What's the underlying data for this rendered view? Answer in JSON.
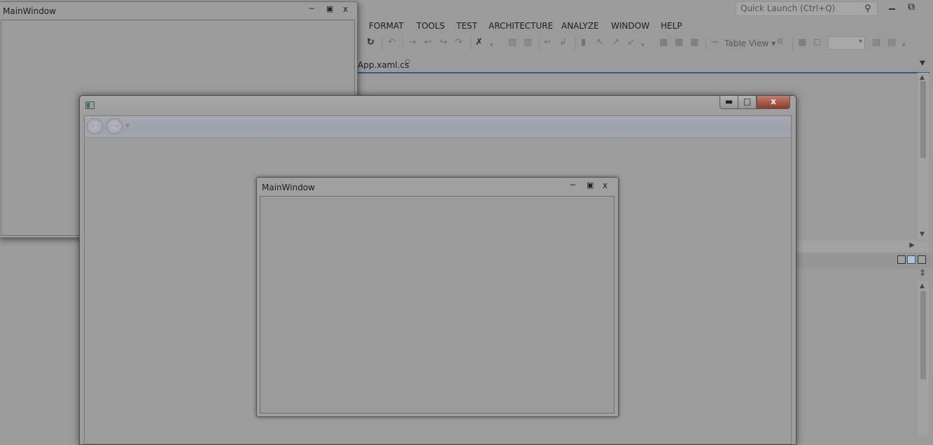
{
  "vs": {
    "quick_launch_placeholder": "Quick Launch (Ctrl+Q)",
    "menu": [
      "FORMAT",
      "TOOLS",
      "TEST",
      "ARCHITECTURE",
      "ANALYZE",
      "WINDOW",
      "HELP"
    ],
    "toolbar": {
      "table_view_label": "Table View"
    },
    "doc_tab": "App.xaml.cs"
  },
  "small_window": {
    "title": "MainWindow"
  },
  "inner_window": {
    "title": "MainWindow"
  },
  "icons": {
    "search": "⚲",
    "close_glyph": "x",
    "restore_glyph": "⧉",
    "back": "←",
    "forward": "→",
    "lock": "🔒"
  }
}
